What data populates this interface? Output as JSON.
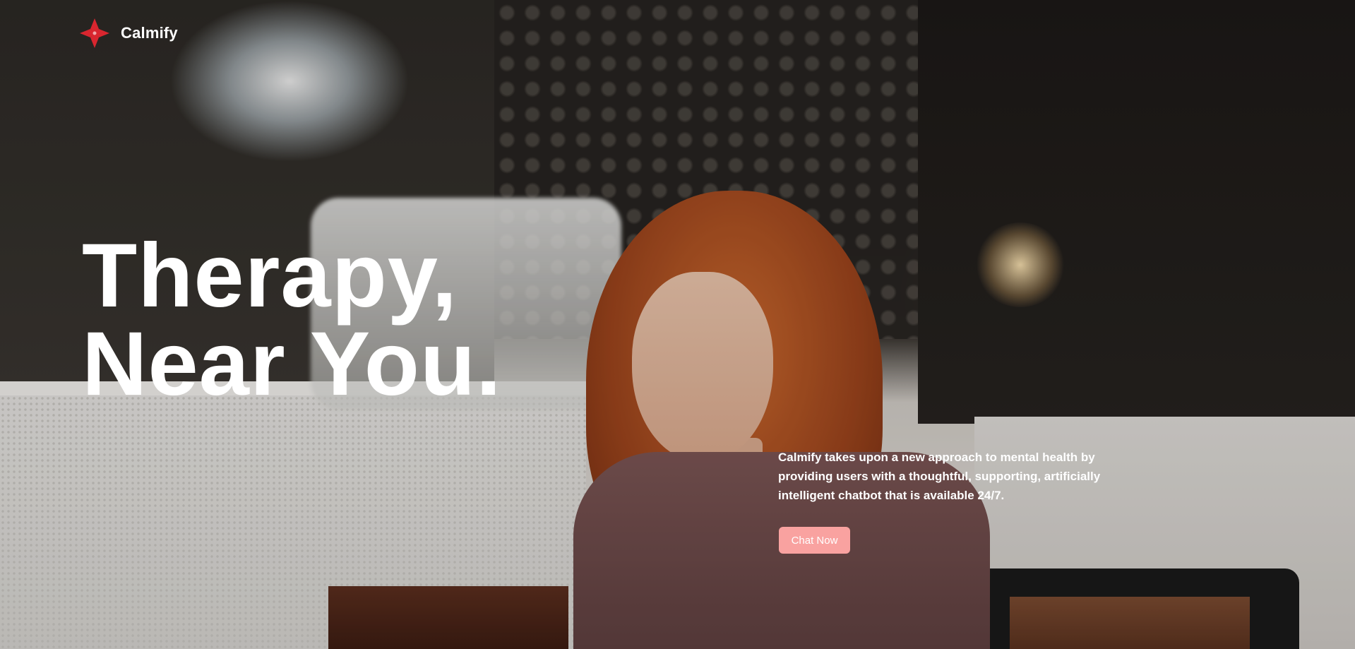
{
  "brand": {
    "name": "Calmify",
    "logo_icon": "flower-logo-icon",
    "accent_color": "#d9262f"
  },
  "hero": {
    "headline_line1": "Therapy,",
    "headline_line2": "Near You.",
    "description": "Calmify takes upon a new approach to mental health by providing users with a thoughtful, supporting, artificially intelligent chatbot that is available 24/7.",
    "cta_label": "Chat Now",
    "cta_color": "#f9a2a0",
    "background_image": "woman-smiling-in-cafe"
  }
}
